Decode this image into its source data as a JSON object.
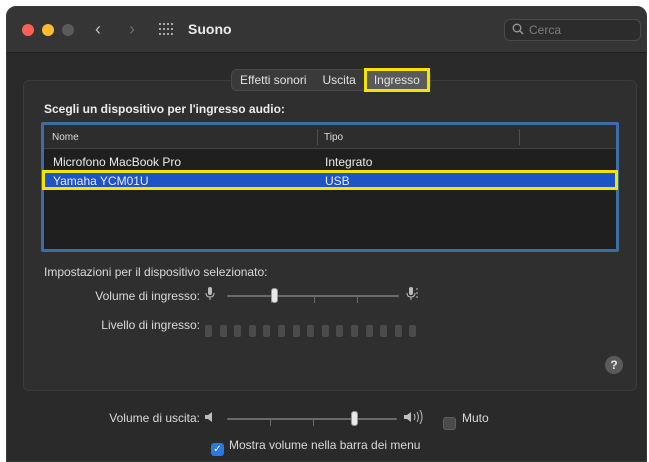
{
  "window": {
    "title": "Suono",
    "search_placeholder": "Cerca"
  },
  "tabs": [
    {
      "label": "Effetti sonori",
      "selected": false
    },
    {
      "label": "Uscita",
      "selected": false
    },
    {
      "label": "Ingresso",
      "selected": true
    }
  ],
  "input": {
    "heading": "Scegli un dispositivo per l'ingresso audio:",
    "columns": [
      "Nome",
      "Tipo"
    ],
    "devices": [
      {
        "name": "Microfono MacBook Pro",
        "type": "Integrato",
        "selected": false
      },
      {
        "name": "Yamaha YCM01U",
        "type": "USB",
        "selected": true
      }
    ],
    "settings_label": "Impostazioni per il dispositivo selezionato:",
    "volume_label": "Volume di ingresso:",
    "volume_value": 0.28,
    "level_label": "Livello di ingresso:",
    "level_value": 0
  },
  "output": {
    "volume_label": "Volume di uscita:",
    "volume_value": 0.75,
    "mute_label": "Muto",
    "mute_checked": false
  },
  "menu_bar_checkbox": {
    "label": "Mostra volume nella barra dei menu",
    "checked": true
  },
  "colors": {
    "selection": "#1c54c6",
    "highlight": "#f4e400",
    "accent": "#2b78e4"
  }
}
